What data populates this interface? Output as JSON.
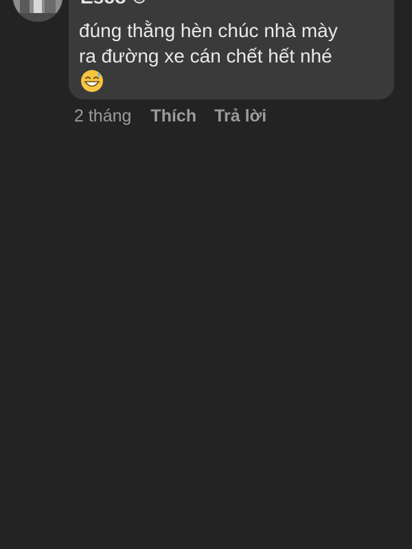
{
  "comment": {
    "author": "Esco",
    "author_badge_icon": "smiley-badge-icon",
    "lines": [
      "đúng thằng hèn chúc nhà mày",
      "ra đường xe cán chết hết nhé"
    ],
    "emoji": "grinning-face-with-sweat-icon",
    "time": "2 tháng",
    "like_label": "Thích",
    "reply_label": "Trả lời"
  },
  "colors": {
    "background": "#232323",
    "bubble": "#3a3a3a",
    "text": "#e9e9e9",
    "meta": "#9b9b9b"
  }
}
